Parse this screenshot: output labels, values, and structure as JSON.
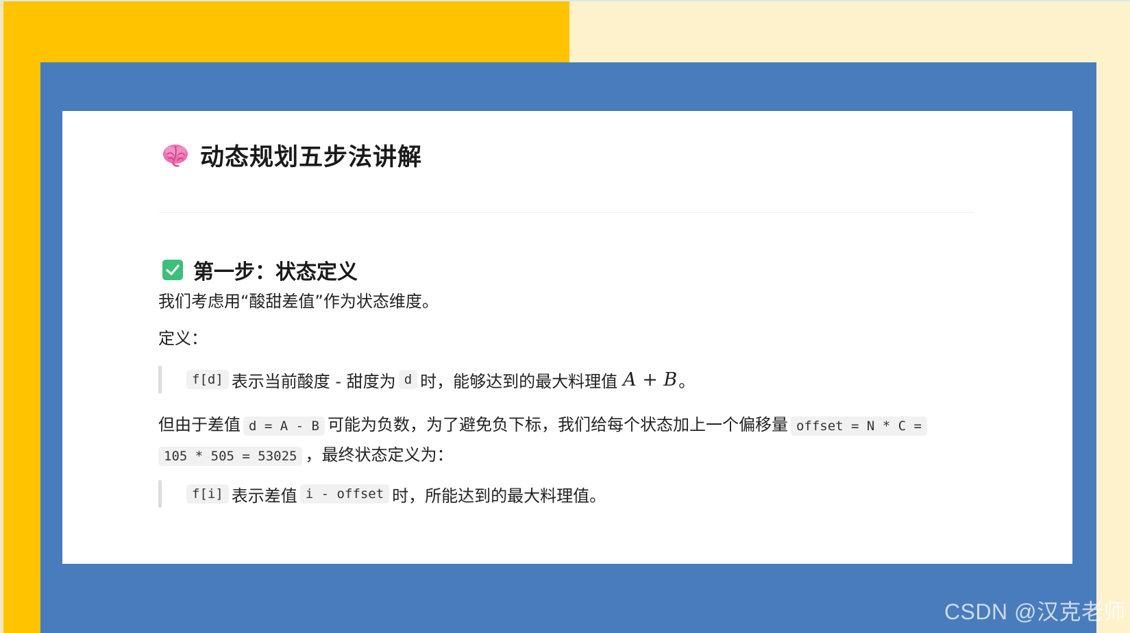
{
  "title": "动态规划五步法讲解",
  "brain_icon": "brain-icon",
  "check_icon": "checkmark-icon",
  "colors": {
    "yellow": "#ffc300",
    "cream": "#fef2cd",
    "blue": "#487cbc",
    "check_green": "#3dbf7a"
  },
  "section": {
    "title": "第一步：状态定义",
    "intro": "我们考虑用“酸甜差值”作为状态维度。",
    "definition_label": "定义：",
    "quote1": {
      "code": "f[d]",
      "text_a": "表示当前酸度 - 甜度为",
      "code_d": "d",
      "text_b": "时，能够达到的最大料理值",
      "math": "A + B",
      "text_c": "。"
    },
    "para2": {
      "text_a": "但由于差值",
      "code_diff": "d = A - B",
      "text_b": "可能为负数，为了避免负下标，我们给每个状态加上一个偏移量",
      "code_offset_1": "offset = N * C =",
      "code_offset_2": "105 * 505 = 53025",
      "text_c": "，最终状态定义为："
    },
    "quote2": {
      "code": "f[i]",
      "text_a": "表示差值",
      "code_i": "i - offset",
      "text_b": "时，所能达到的最大料理值。"
    }
  },
  "watermark": "CSDN @汉克老师"
}
